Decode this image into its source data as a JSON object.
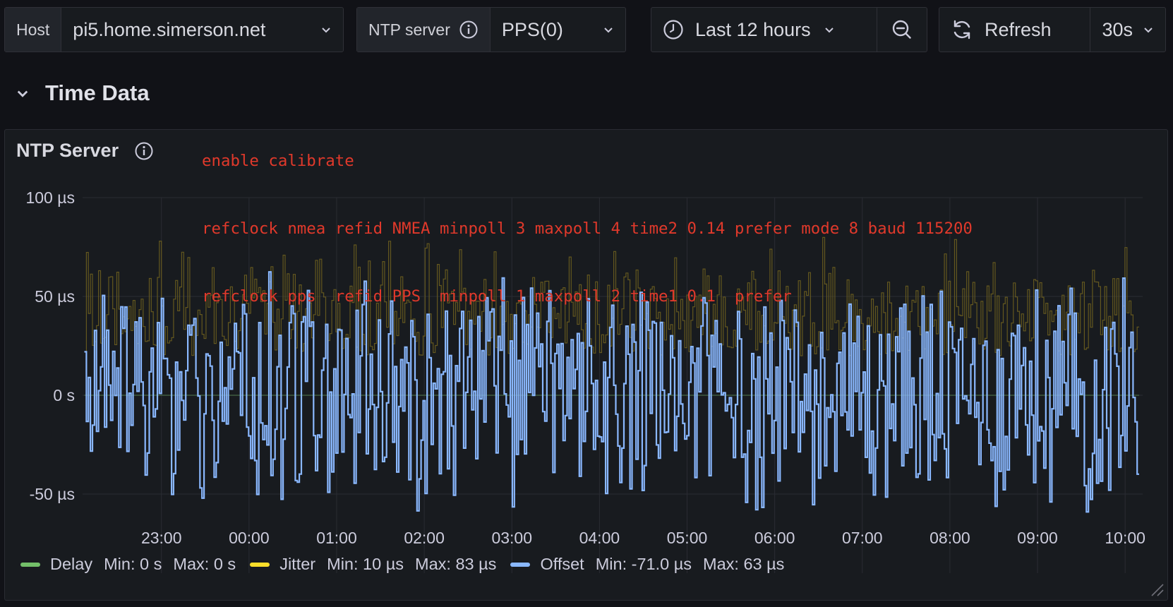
{
  "toolbar": {
    "host": {
      "label": "Host",
      "value": "pi5.home.simerson.net"
    },
    "ntp": {
      "label": "NTP server",
      "value": "PPS(0)"
    },
    "time_range": "Last 12 hours",
    "refresh_label": "Refresh",
    "refresh_interval": "30s"
  },
  "row": {
    "title": "Time Data"
  },
  "annotation": {
    "lines": [
      "enable calibrate",
      "refclock nmea refid NMEA minpoll 3 maxpoll 4 time2 0.14 prefer mode 8 baud 115200",
      "refclock pps  refid PPS  minpoll 1 maxpoll 2 time1 0.1  prefer"
    ]
  },
  "panel": {
    "title": "NTP Server"
  },
  "legend": [
    {
      "name": "Delay",
      "min": "Min: 0 s",
      "max": "Max: 0 s",
      "color": "#73bf69"
    },
    {
      "name": "Jitter",
      "min": "Min: 10 µs",
      "max": "Max: 83 µs",
      "color": "#fade2a"
    },
    {
      "name": "Offset",
      "min": "Min: -71.0 µs",
      "max": "Max: 63 µs",
      "color": "#8ab8ff"
    }
  ],
  "colors": {
    "background": "#111217",
    "panel": "#181b1f",
    "grid": "#2a2c33",
    "annotation": "#e0392b"
  },
  "chart_data": {
    "type": "line",
    "y_tick_labels": [
      "100 µs",
      "50 µs",
      "0 s",
      "-50 µs"
    ],
    "y_tick_values": [
      100,
      50,
      0,
      -50
    ],
    "ylim": [
      -90,
      100
    ],
    "x_tick_labels": [
      "23:00",
      "00:00",
      "01:00",
      "02:00",
      "03:00",
      "04:00",
      "05:00",
      "06:00",
      "07:00",
      "08:00",
      "09:00",
      "10:00"
    ],
    "x_range_hours": [
      22.1,
      34.2
    ],
    "grid": true,
    "legend_position": "bottom-left",
    "series": [
      {
        "name": "Delay",
        "color": "#73bf69",
        "min": 0,
        "max": 0
      },
      {
        "name": "Jitter",
        "color": "#fade2a",
        "min": 10,
        "max": 83
      },
      {
        "name": "Offset",
        "color": "#8ab8ff",
        "min": -71.0,
        "max": 63
      }
    ]
  }
}
